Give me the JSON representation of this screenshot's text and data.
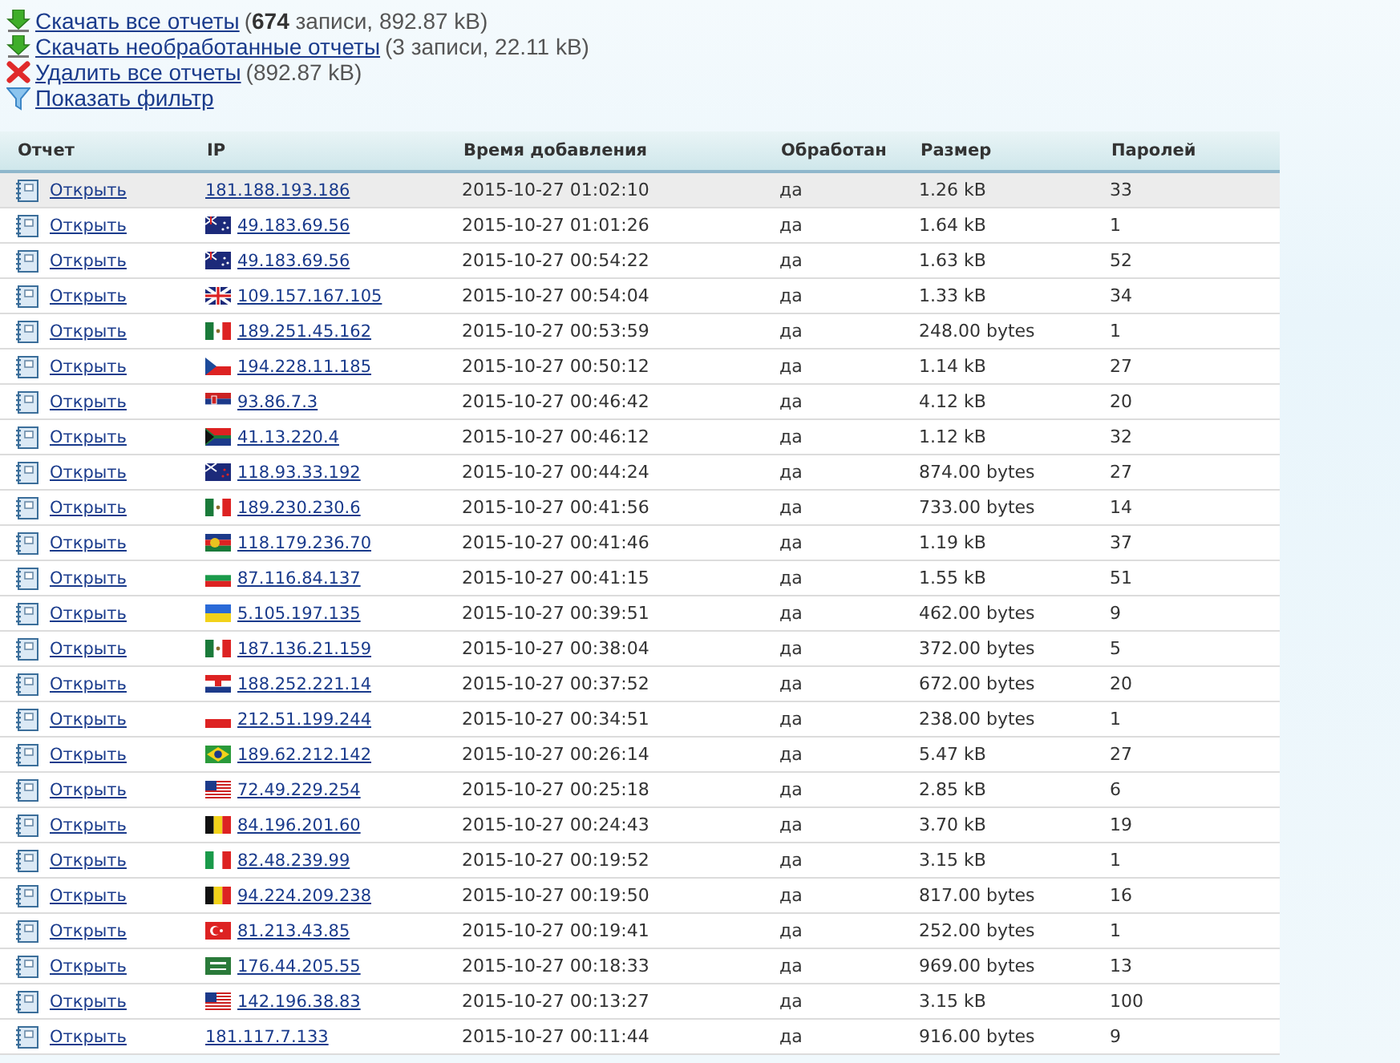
{
  "actions": [
    {
      "kind": "download",
      "link": "Скачать все отчеты",
      "note": "(**674** записи, 892.87 kB)"
    },
    {
      "kind": "download",
      "link": "Скачать необработанные отчеты",
      "note": "(3 записи, 22.11 kB)"
    },
    {
      "kind": "delete",
      "link": "Удалить все отчеты",
      "note": "(892.87 kB)"
    },
    {
      "kind": "filter",
      "link": "Показать фильтр"
    }
  ],
  "table": {
    "columns": [
      "Отчет",
      "IP",
      "Время добавления",
      "Обработан",
      "Размер",
      "Паролей"
    ],
    "rows": [
      {
        "selected": true,
        "open": "Открыть",
        "kind": "none",
        "ip": "181.188.193.186",
        "time": "2015-10-27 01:02:10",
        "processed": "да",
        "size": "1.26 kB",
        "passwords": "33"
      },
      {
        "selected": false,
        "open": "Открыть",
        "kind": "au",
        "ip": "49.183.69.56",
        "time": "2015-10-27 01:01:26",
        "processed": "да",
        "size": "1.64 kB",
        "passwords": "1"
      },
      {
        "selected": false,
        "open": "Открыть",
        "kind": "au",
        "ip": "49.183.69.56",
        "time": "2015-10-27 00:54:22",
        "processed": "да",
        "size": "1.63 kB",
        "passwords": "52"
      },
      {
        "selected": false,
        "open": "Открыть",
        "kind": "gb",
        "ip": "109.157.167.105",
        "time": "2015-10-27 00:54:04",
        "processed": "да",
        "size": "1.33 kB",
        "passwords": "34"
      },
      {
        "selected": false,
        "open": "Открыть",
        "kind": "mx",
        "ip": "189.251.45.162",
        "time": "2015-10-27 00:53:59",
        "processed": "да",
        "size": "248.00 bytes",
        "passwords": "1"
      },
      {
        "selected": false,
        "open": "Открыть",
        "kind": "cz",
        "ip": "194.228.11.185",
        "time": "2015-10-27 00:50:12",
        "processed": "да",
        "size": "1.14 kB",
        "passwords": "27"
      },
      {
        "selected": false,
        "open": "Открыть",
        "kind": "rs",
        "ip": "93.86.7.3",
        "time": "2015-10-27 00:46:42",
        "processed": "да",
        "size": "4.12 kB",
        "passwords": "20"
      },
      {
        "selected": false,
        "open": "Открыть",
        "kind": "za",
        "ip": "41.13.220.4",
        "time": "2015-10-27 00:46:12",
        "processed": "да",
        "size": "1.12 kB",
        "passwords": "32"
      },
      {
        "selected": false,
        "open": "Открыть",
        "kind": "nz",
        "ip": "118.93.33.192",
        "time": "2015-10-27 00:44:24",
        "processed": "да",
        "size": "874.00 bytes",
        "passwords": "27"
      },
      {
        "selected": false,
        "open": "Открыть",
        "kind": "mx",
        "ip": "189.230.230.6",
        "time": "2015-10-27 00:41:56",
        "processed": "да",
        "size": "733.00 bytes",
        "passwords": "14"
      },
      {
        "selected": false,
        "open": "Открыть",
        "kind": "nc",
        "ip": "118.179.236.70",
        "time": "2015-10-27 00:41:46",
        "processed": "да",
        "size": "1.19 kB",
        "passwords": "37"
      },
      {
        "selected": false,
        "open": "Открыть",
        "kind": "bg",
        "ip": "87.116.84.137",
        "time": "2015-10-27 00:41:15",
        "processed": "да",
        "size": "1.55 kB",
        "passwords": "51"
      },
      {
        "selected": false,
        "open": "Открыть",
        "kind": "ua",
        "ip": "5.105.197.135",
        "time": "2015-10-27 00:39:51",
        "processed": "да",
        "size": "462.00 bytes",
        "passwords": "9"
      },
      {
        "selected": false,
        "open": "Открыть",
        "kind": "mx",
        "ip": "187.136.21.159",
        "time": "2015-10-27 00:38:04",
        "processed": "да",
        "size": "372.00 bytes",
        "passwords": "5"
      },
      {
        "selected": false,
        "open": "Открыть",
        "kind": "hr",
        "ip": "188.252.221.14",
        "time": "2015-10-27 00:37:52",
        "processed": "да",
        "size": "672.00 bytes",
        "passwords": "20"
      },
      {
        "selected": false,
        "open": "Открыть",
        "kind": "pl",
        "ip": "212.51.199.244",
        "time": "2015-10-27 00:34:51",
        "processed": "да",
        "size": "238.00 bytes",
        "passwords": "1"
      },
      {
        "selected": false,
        "open": "Открыть",
        "kind": "br",
        "ip": "189.62.212.142",
        "time": "2015-10-27 00:26:14",
        "processed": "да",
        "size": "5.47 kB",
        "passwords": "27"
      },
      {
        "selected": false,
        "open": "Открыть",
        "kind": "us",
        "ip": "72.49.229.254",
        "time": "2015-10-27 00:25:18",
        "processed": "да",
        "size": "2.85 kB",
        "passwords": "6"
      },
      {
        "selected": false,
        "open": "Открыть",
        "kind": "be",
        "ip": "84.196.201.60",
        "time": "2015-10-27 00:24:43",
        "processed": "да",
        "size": "3.70 kB",
        "passwords": "19"
      },
      {
        "selected": false,
        "open": "Открыть",
        "kind": "it",
        "ip": "82.48.239.99",
        "time": "2015-10-27 00:19:52",
        "processed": "да",
        "size": "3.15 kB",
        "passwords": "1"
      },
      {
        "selected": false,
        "open": "Открыть",
        "kind": "be",
        "ip": "94.224.209.238",
        "time": "2015-10-27 00:19:50",
        "processed": "да",
        "size": "817.00 bytes",
        "passwords": "16"
      },
      {
        "selected": false,
        "open": "Открыть",
        "kind": "tr",
        "ip": "81.213.43.85",
        "time": "2015-10-27 00:19:41",
        "processed": "да",
        "size": "252.00 bytes",
        "passwords": "1"
      },
      {
        "selected": false,
        "open": "Открыть",
        "kind": "sa",
        "ip": "176.44.205.55",
        "time": "2015-10-27 00:18:33",
        "processed": "да",
        "size": "969.00 bytes",
        "passwords": "13"
      },
      {
        "selected": false,
        "open": "Открыть",
        "kind": "us",
        "ip": "142.196.38.83",
        "time": "2015-10-27 00:13:27",
        "processed": "да",
        "size": "3.15 kB",
        "passwords": "100"
      },
      {
        "selected": false,
        "open": "Открыть",
        "kind": "none",
        "ip": "181.117.7.133",
        "time": "2015-10-27 00:11:44",
        "processed": "да",
        "size": "916.00 bytes",
        "passwords": "9"
      }
    ]
  }
}
